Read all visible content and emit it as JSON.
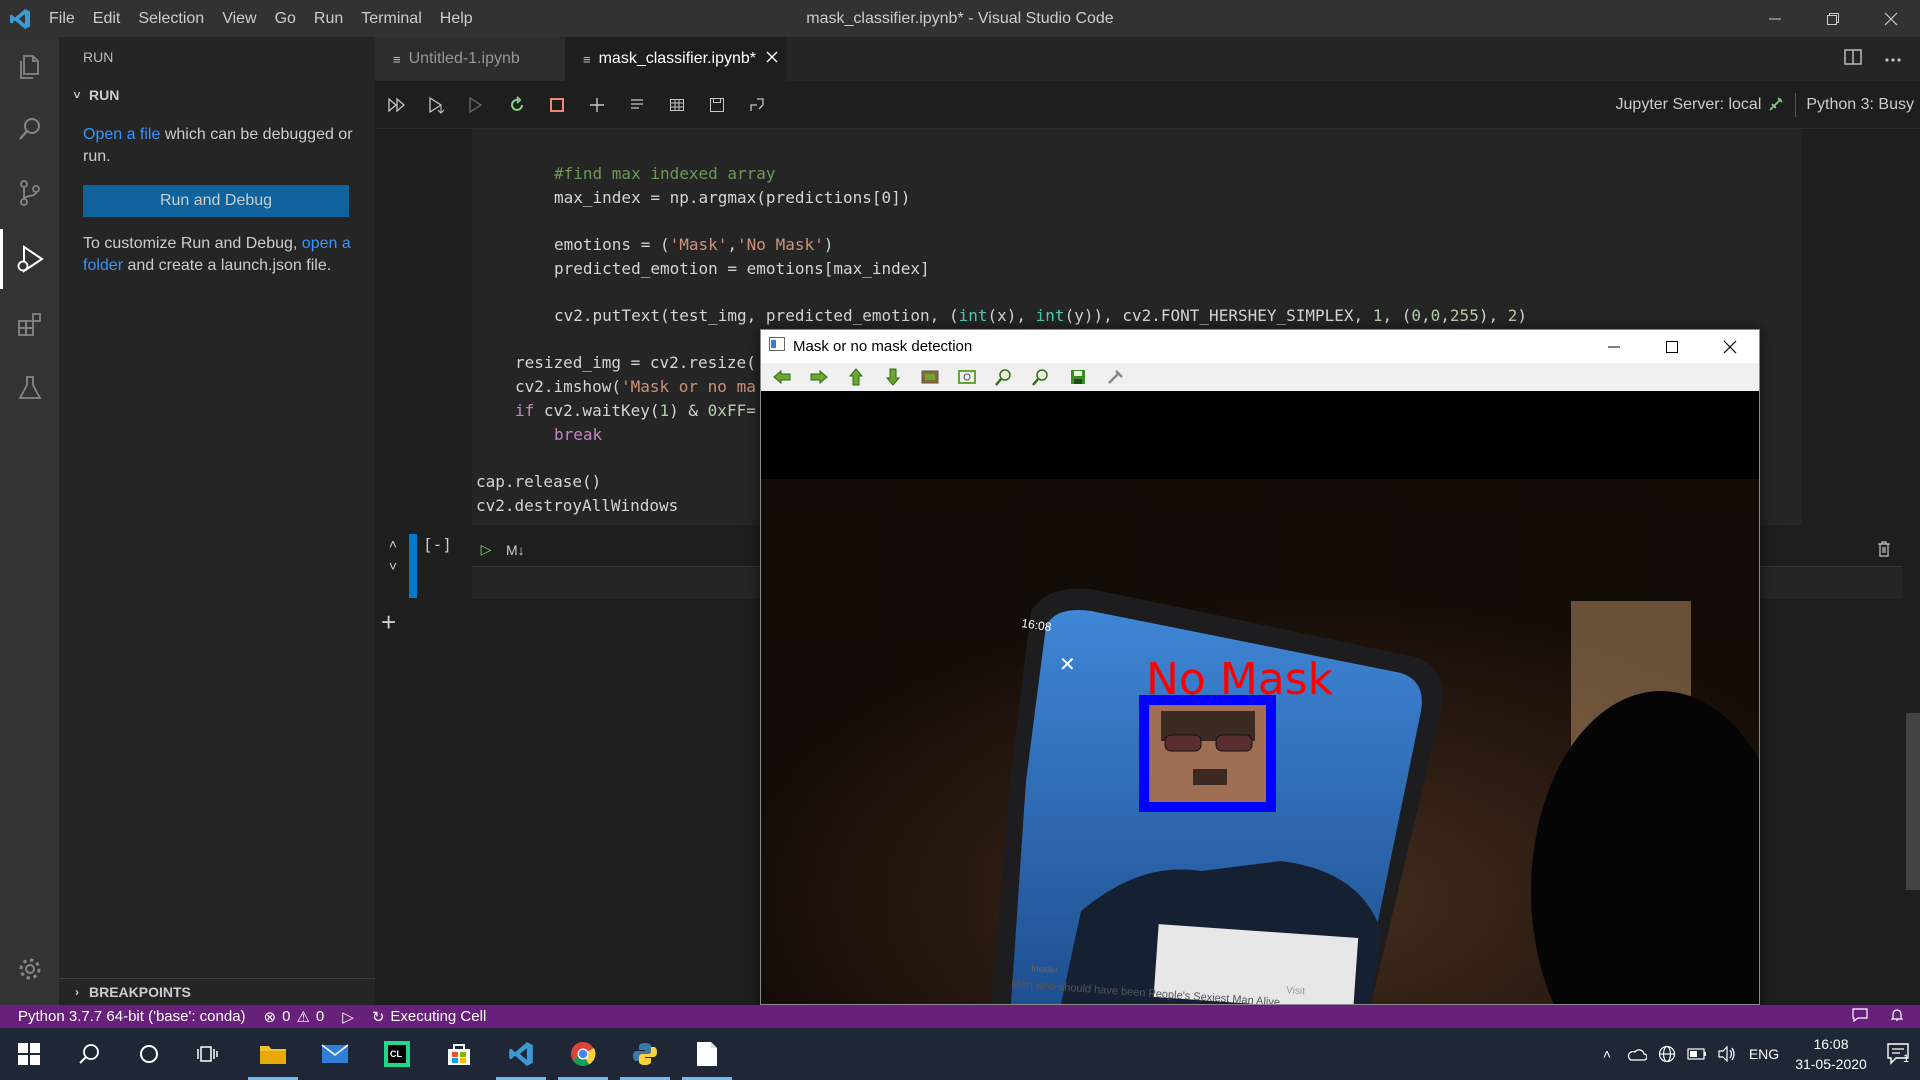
{
  "window": {
    "title": "mask_classifier.ipynb* - Visual Studio Code"
  },
  "menu": [
    "File",
    "Edit",
    "Selection",
    "View",
    "Go",
    "Run",
    "Terminal",
    "Help"
  ],
  "sidebar": {
    "header": "RUN",
    "section": "RUN",
    "open_file_link": "Open a file",
    "open_file_rest": " which can be debugged or run.",
    "run_button": "Run and Debug",
    "customize_prefix": "To customize Run and Debug, ",
    "open_folder_link": "open a folder",
    "customize_suffix": " and create a launch.json file.",
    "breakpoints": "BREAKPOINTS"
  },
  "tabs": [
    {
      "label": "Untitled-1.ipynb"
    },
    {
      "label": "mask_classifier.ipynb*"
    }
  ],
  "notebook": {
    "server": "Jupyter Server: local",
    "kernel": "Python 3: Busy",
    "execution_count": "[-]",
    "md_label": "M↓"
  },
  "code": {
    "line1_comment": "#find max indexed array",
    "line2": "max_index = np.argmax(predictions[0])",
    "line3_a": "emotions = (",
    "line3_s1": "'Mask'",
    "line3_b": ",",
    "line3_s2": "'No Mask'",
    "line3_c": ")",
    "line4": "predicted_emotion = emotions[max_index]",
    "line5_a": "cv2.putText(test_img, predicted_emotion, (",
    "line5_int1": "int",
    "line5_b": "(x), ",
    "line5_int2": "int",
    "line5_c": "(y)), cv2.FONT_HERSHEY_SIMPLEX, ",
    "line5_n1": "1",
    "line5_d": ", (",
    "line5_n2": "0",
    "line5_e": ",",
    "line5_n3": "0",
    "line5_f": ",",
    "line5_n4": "255",
    "line5_g": "), ",
    "line5_n5": "2",
    "line5_h": ")",
    "line6": "resized_img = cv2.resize(",
    "line7_a": "cv2.imshow(",
    "line7_s": "'Mask or no ma",
    "line8_kw": "if",
    "line8_a": " cv2.waitKey(",
    "line8_n": "1",
    "line8_b": ") & ",
    "line8_hex": "0xFF=",
    "line9_kw": "break",
    "line10": "cap.release()",
    "line11": "cv2.destroyAllWindows"
  },
  "statusbar": {
    "interpreter": "Python 3.7.7 64-bit ('base': conda)",
    "errors": "0",
    "warnings": "0",
    "executing": "Executing Cell"
  },
  "cv_window": {
    "title": "Mask or no mask detection",
    "overlay_text": "No Mask",
    "phone_time": "16:08",
    "card_source": "Insider",
    "card_text": "Men who should have been People's Sexiest Man Alive",
    "card_button": "Visit"
  },
  "taskbar": {
    "language": "ENG",
    "time": "16:08",
    "date": "31-05-2020",
    "notifications": "1"
  },
  "colors": {
    "statusbar": "#68217a",
    "accent": "#007acc",
    "overlay_text": "#ff0000",
    "face_box": "#0000ff"
  }
}
